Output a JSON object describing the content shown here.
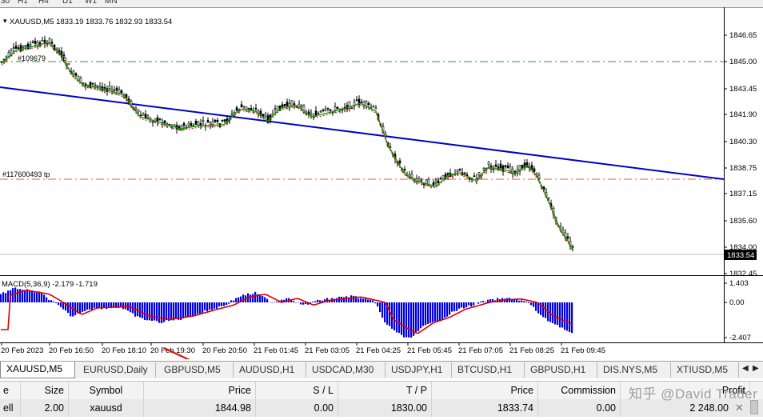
{
  "timeframes": [
    "30",
    "H1",
    "H4",
    "D1",
    "W1",
    "MN"
  ],
  "chart": {
    "symbol_info": "XAUUSD,M5  1833.19 1833.76 1832.93 1833.54",
    "order_label_1": "#109679",
    "order_label_1_suffix": "tp",
    "order_label_2": "#117600493 tp",
    "price_current": "1833.54",
    "price_ticks": [
      "1846.65",
      "1845.00",
      "1843.45",
      "1841.90",
      "1840.30",
      "1838.75",
      "1837.15",
      "1835.60",
      "1834.00",
      "1832.45"
    ],
    "macd_label": "MACD(5,36,9) -2.179 -1.719",
    "macd_ticks": [
      "1.403",
      "0.00",
      "-2.407"
    ],
    "time_ticks": [
      "20 Feb 2023",
      "20 Feb 16:50",
      "20 Feb 18:10",
      "20 Feb 19:30",
      "20 Feb 20:50",
      "21 Feb 01:45",
      "21 Feb 03:05",
      "21 Feb 04:25",
      "21 Feb 05:45",
      "21 Feb 07:05",
      "21 Feb 08:25",
      "21 Feb 09:45"
    ]
  },
  "tabs": [
    {
      "label": "XAUUSD,M5",
      "active": true
    },
    {
      "label": "EURUSD,Daily"
    },
    {
      "label": "GBPUSD,M5"
    },
    {
      "label": "AUDUSD,H1"
    },
    {
      "label": "USDCAD,M30"
    },
    {
      "label": "USDJPY,H1"
    },
    {
      "label": "BTCUSD,H1"
    },
    {
      "label": "GBPUSD,H1"
    },
    {
      "label": "DIS.NYS,M5"
    },
    {
      "label": "XTIUSD,M5"
    }
  ],
  "table": {
    "headers": {
      "type": "e",
      "size": "Size",
      "symbol": "Symbol",
      "price": "Price",
      "sl": "S / L",
      "tp": "T / P",
      "price2": "Price",
      "commission": "Commission",
      "profit": "Profit"
    },
    "row": {
      "type": "ell",
      "size": "2.00",
      "symbol": "xauusd",
      "price": "1844.98",
      "sl": "0.00",
      "tp": "1830.00",
      "price2": "1833.74",
      "commission": "0.00",
      "profit": "2 248.00"
    }
  },
  "watermark": "知乎 @David Trader",
  "colors": {
    "trendline": "#0000cc",
    "arrow": "#e01010",
    "ma_green": "#00a000",
    "ma_red": "#e00000",
    "macd_bar": "#0000e0",
    "signal": "#dd0000",
    "tp_line": "#e06020",
    "green_dash": "#2a9a2a"
  },
  "icons": [
    "tab-scroll-left-icon",
    "tab-scroll-right-icon",
    "close-icon",
    "arrow-annotation-icon"
  ]
}
